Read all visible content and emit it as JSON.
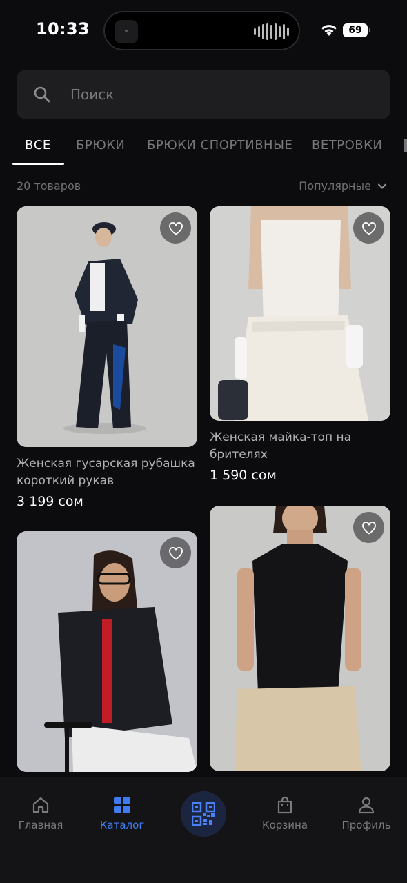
{
  "status": {
    "time": "10:33",
    "island_left": "-",
    "battery": "69"
  },
  "search": {
    "placeholder": "Поиск"
  },
  "tabs": [
    {
      "label": "ВСЕ",
      "active": true
    },
    {
      "label": "БРЮКИ",
      "active": false
    },
    {
      "label": "БРЮКИ СПОРТИВНЫЕ",
      "active": false
    },
    {
      "label": "ВЕТРОВКИ",
      "active": false
    }
  ],
  "listing": {
    "count": "20 товаров",
    "sort": "Популярные"
  },
  "products": [
    {
      "name": "Женская гусарская рубашка короткий рукав",
      "price": "3 199 сом",
      "icon": "heart-outline-icon"
    },
    {
      "name": "Женская майка-топ на брителях",
      "price": "1 590 сом",
      "icon": "heart-outline-icon"
    },
    {
      "name": "",
      "price": "",
      "icon": "heart-outline-icon"
    },
    {
      "name": "",
      "price": "",
      "icon": "heart-outline-icon"
    }
  ],
  "nav": {
    "home": "Главная",
    "catalog": "Каталог",
    "cart": "Корзина",
    "profile": "Профиль"
  },
  "colors": {
    "accent": "#3f7cf2",
    "background": "#0c0c0e",
    "surface": "#1e1e21"
  }
}
